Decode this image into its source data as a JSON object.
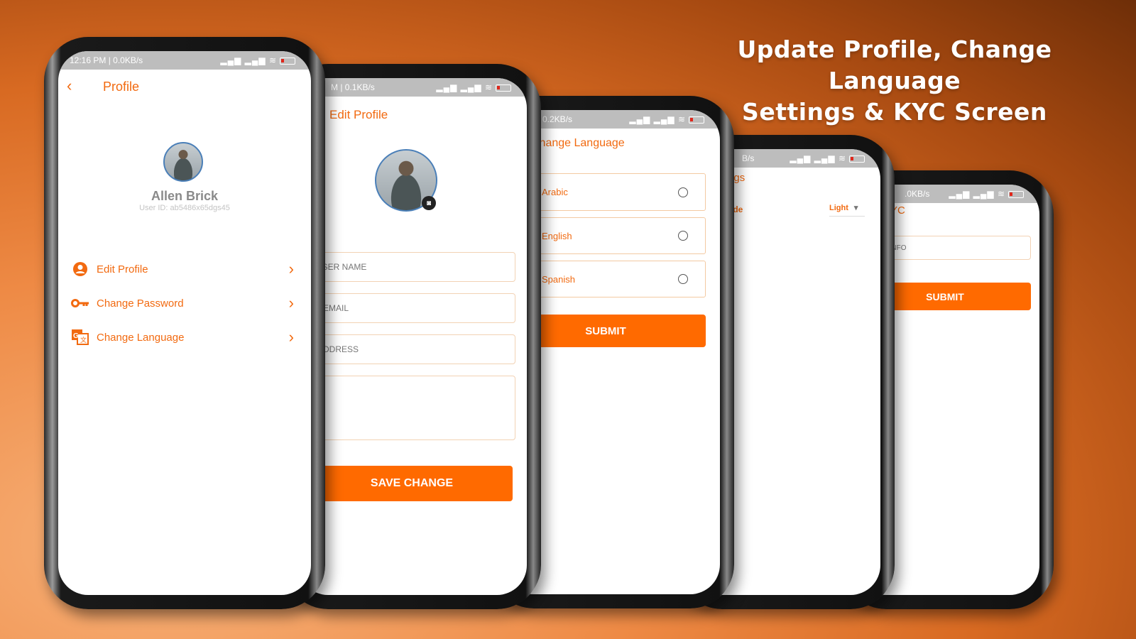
{
  "headline": {
    "line1": "Update Profile, Change Language",
    "line2": "Settings & KYC Screen"
  },
  "colors": {
    "accent": "#ff6a00",
    "title": "#f26a10"
  },
  "profile": {
    "status_left": "12:16 PM | 0.0KB/s",
    "battery": "18",
    "title": "Profile",
    "name": "Allen Brick",
    "user_id": "User ID: ab5486x65dgs45",
    "menu": [
      {
        "label": "Edit Profile",
        "icon": "user-circle-icon"
      },
      {
        "label": "Change Password",
        "icon": "key-icon"
      },
      {
        "label": "Change Language",
        "icon": "translate-icon"
      }
    ]
  },
  "edit_profile": {
    "status_left": "M | 0.1KB/s",
    "title": "Edit Profile",
    "fields": [
      "USER NAME",
      "EMAIL",
      "ADDRESS"
    ],
    "save": "SAVE CHANGE"
  },
  "change_language": {
    "status_left": "0.2KB/s",
    "title": "Change Language",
    "options": [
      "Arabic",
      "English",
      "Spanish"
    ],
    "submit": "SUBMIT"
  },
  "settings": {
    "status_left": "B/s",
    "battery": "17",
    "title": "Settings",
    "mode_label": "Mode",
    "mode_value": "Light"
  },
  "kyc": {
    "status_left": ".0KB/s",
    "battery": "17",
    "title": "KYC",
    "field": "YOUR INFO",
    "submit": "SUBMIT"
  }
}
